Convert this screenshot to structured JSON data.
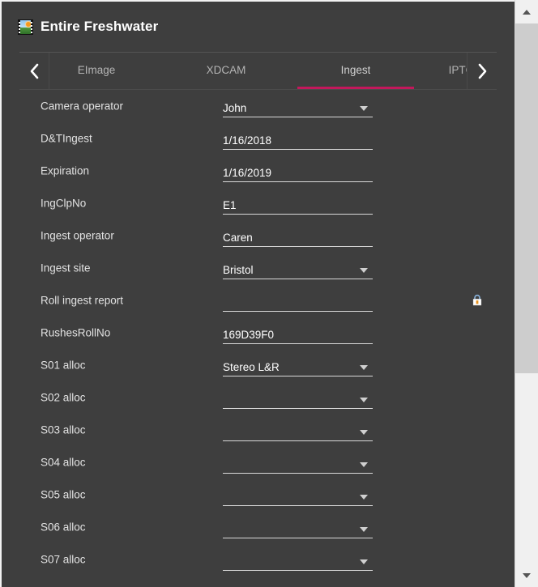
{
  "window": {
    "title": "Entire Freshwater",
    "title_icon": "image-thumbnail-icon"
  },
  "tabbar": {
    "prev_icon": "chevron-left-icon",
    "next_icon": "chevron-right-icon",
    "tabs": [
      {
        "label": "EImage",
        "active": false,
        "clipped": true
      },
      {
        "label": "XDCAM",
        "active": false,
        "clipped": false
      },
      {
        "label": "Ingest",
        "active": true,
        "clipped": false
      },
      {
        "label": "IPTC.Envelope",
        "active": false,
        "clipped": true
      }
    ],
    "active_tab": "Ingest",
    "active_indicator_color": "#c2185b"
  },
  "colors": {
    "background": "#3e3e3e",
    "text_primary": "#ffffff",
    "text_label": "#e2e2e2",
    "text_tab_inactive": "#b4b4b4",
    "field_underline": "#d9d9d9",
    "accent": "#c2185b",
    "scrollbar_track": "#f0f0f0",
    "scrollbar_thumb": "#cdcdcd"
  },
  "form": {
    "rows": [
      {
        "label": "Camera operator",
        "value": "John",
        "type": "dropdown",
        "locked": false
      },
      {
        "label": "D&TIngest",
        "value": "1/16/2018",
        "type": "text",
        "locked": false
      },
      {
        "label": "Expiration",
        "value": "1/16/2019",
        "type": "text",
        "locked": false
      },
      {
        "label": "IngClpNo",
        "value": "E1",
        "type": "text",
        "locked": false
      },
      {
        "label": "Ingest operator",
        "value": "Caren",
        "type": "text",
        "locked": false
      },
      {
        "label": "Ingest site",
        "value": "Bristol",
        "type": "dropdown",
        "locked": false
      },
      {
        "label": "Roll ingest report",
        "value": "",
        "type": "text",
        "locked": true
      },
      {
        "label": "RushesRollNo",
        "value": "169D39F0",
        "type": "text",
        "locked": false
      },
      {
        "label": "S01 alloc",
        "value": "Stereo L&R",
        "type": "dropdown",
        "locked": false
      },
      {
        "label": "S02 alloc",
        "value": "",
        "type": "dropdown",
        "locked": false
      },
      {
        "label": "S03 alloc",
        "value": "",
        "type": "dropdown",
        "locked": false
      },
      {
        "label": "S04 alloc",
        "value": "",
        "type": "dropdown",
        "locked": false
      },
      {
        "label": "S05 alloc",
        "value": "",
        "type": "dropdown",
        "locked": false
      },
      {
        "label": "S06 alloc",
        "value": "",
        "type": "dropdown",
        "locked": false
      },
      {
        "label": "S07 alloc",
        "value": "",
        "type": "dropdown",
        "locked": false
      }
    ]
  },
  "scrollbar": {
    "up_icon": "chevron-up-icon",
    "down_icon": "chevron-down-icon",
    "orientation": "vertical"
  }
}
